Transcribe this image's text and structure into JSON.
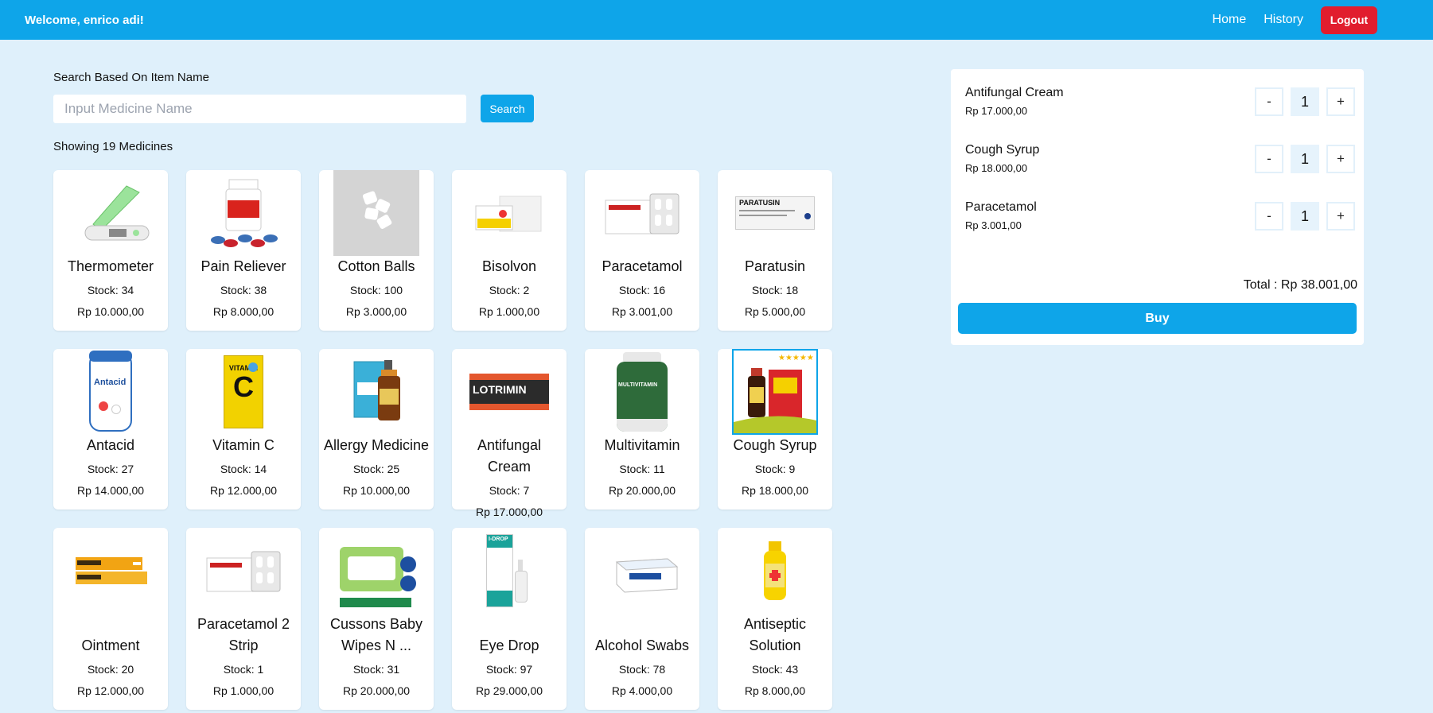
{
  "header": {
    "welcome": "Welcome, enrico adi!",
    "nav_home": "Home",
    "nav_history": "History",
    "logout": "Logout"
  },
  "search": {
    "label": "Search Based On Item Name",
    "placeholder": "Input Medicine Name",
    "button": "Search"
  },
  "showing": "Showing 19 Medicines",
  "products": [
    {
      "name": "Thermometer",
      "stock": "Stock: 34",
      "price": "Rp 10.000,00"
    },
    {
      "name": "Pain Reliever",
      "stock": "Stock: 38",
      "price": "Rp 8.000,00"
    },
    {
      "name": "Cotton Balls",
      "stock": "Stock: 100",
      "price": "Rp 3.000,00"
    },
    {
      "name": "Bisolvon",
      "stock": "Stock: 2",
      "price": "Rp 1.000,00"
    },
    {
      "name": "Paracetamol",
      "stock": "Stock: 16",
      "price": "Rp 3.001,00"
    },
    {
      "name": "Paratusin",
      "stock": "Stock: 18",
      "price": "Rp 5.000,00"
    },
    {
      "name": "Antacid",
      "stock": "Stock: 27",
      "price": "Rp 14.000,00"
    },
    {
      "name": "Vitamin C",
      "stock": "Stock: 14",
      "price": "Rp 12.000,00"
    },
    {
      "name": "Allergy Medicine",
      "stock": "Stock: 25",
      "price": "Rp 10.000,00"
    },
    {
      "name": "Antifungal Cream",
      "stock": "Stock: 7",
      "price": "Rp 17.000,00"
    },
    {
      "name": "Multivitamin",
      "stock": "Stock: 11",
      "price": "Rp 20.000,00"
    },
    {
      "name": "Cough Syrup",
      "stock": "Stock: 9",
      "price": "Rp 18.000,00"
    },
    {
      "name": "Ointment",
      "stock": "Stock: 20",
      "price": "Rp 12.000,00"
    },
    {
      "name": "Paracetamol 2 Strip",
      "stock": "Stock: 1",
      "price": "Rp 1.000,00"
    },
    {
      "name": "Cussons Baby Wipes N ...",
      "stock": "Stock: 31",
      "price": "Rp 20.000,00"
    },
    {
      "name": "Eye Drop",
      "stock": "Stock: 97",
      "price": "Rp 29.000,00"
    },
    {
      "name": "Alcohol Swabs",
      "stock": "Stock: 78",
      "price": "Rp 4.000,00"
    },
    {
      "name": "Antiseptic Solution",
      "stock": "Stock: 43",
      "price": "Rp 8.000,00"
    }
  ],
  "cart": {
    "items": [
      {
        "name": "Antifungal Cream",
        "price": "Rp 17.000,00",
        "qty": "1",
        "minus": "-",
        "plus": "+"
      },
      {
        "name": "Cough Syrup",
        "price": "Rp 18.000,00",
        "qty": "1",
        "minus": "-",
        "plus": "+"
      },
      {
        "name": "Paracetamol",
        "price": "Rp 3.001,00",
        "qty": "1",
        "minus": "-",
        "plus": "+"
      }
    ],
    "total": "Total : Rp 38.001,00",
    "buy": "Buy"
  },
  "image_texts": {
    "paratusin": "PARATUSIN",
    "antacid": "Antacid",
    "vitamin_c": "VITAMIN",
    "vitamin_c_big": "C",
    "lotrimin": "LOTRIMIN",
    "multivitamin": "MULTIVITAMIN",
    "eye_drop": "I-DROP"
  },
  "colors": {
    "primary": "#0ea5e9",
    "logout": "#e11d2e",
    "page_bg": "#dff0fb"
  }
}
